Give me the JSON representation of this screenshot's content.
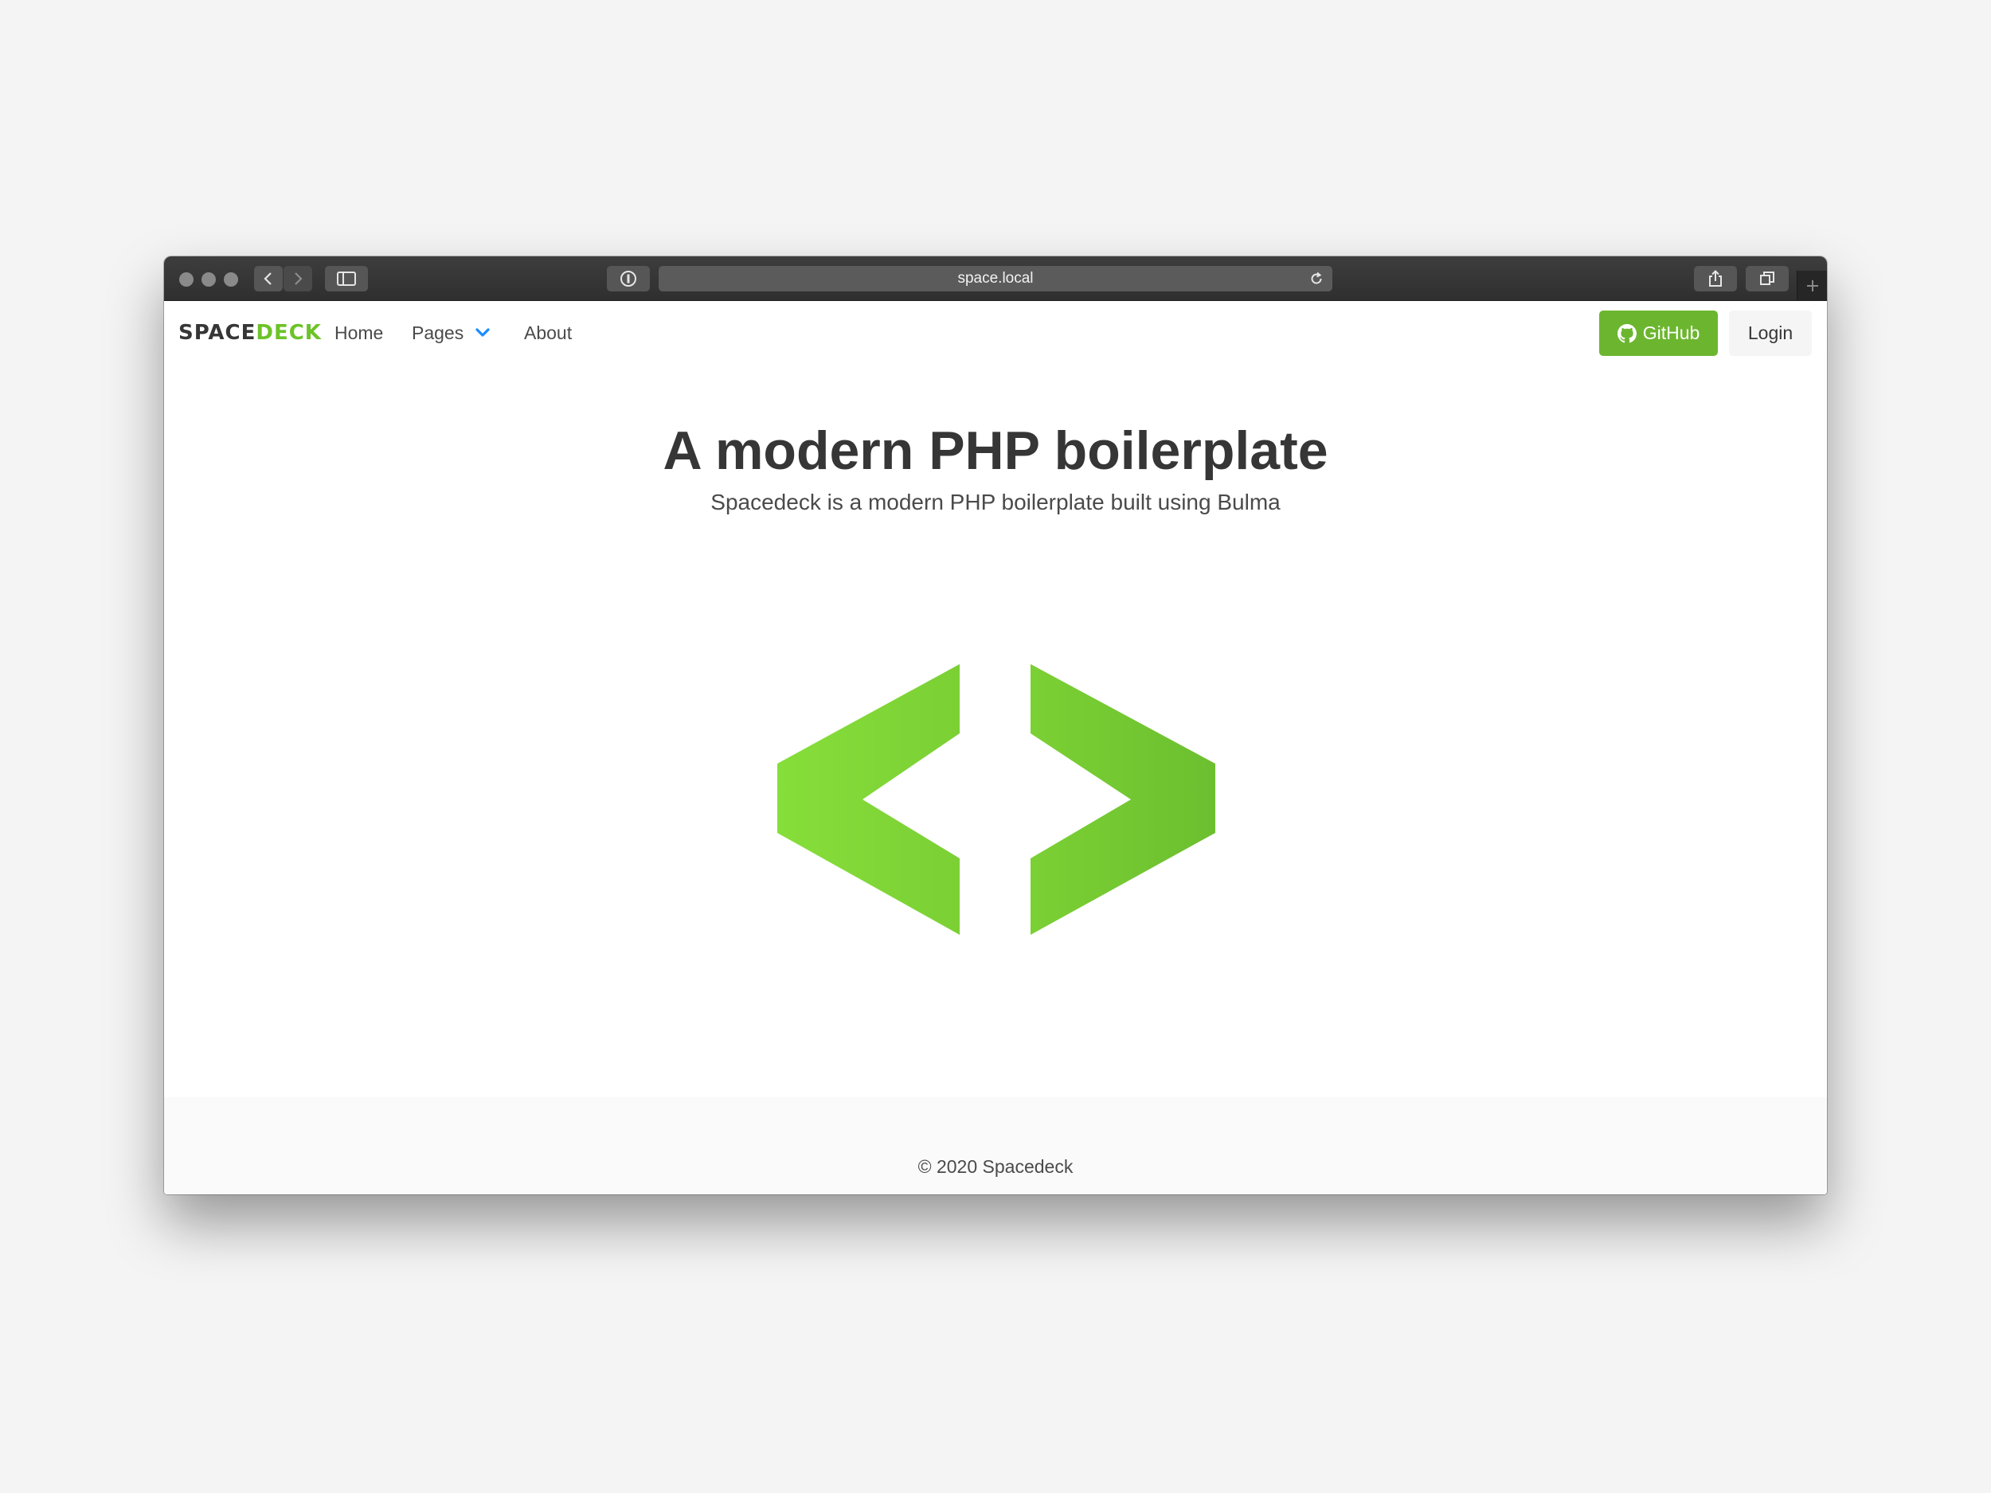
{
  "browser": {
    "url": "space.local"
  },
  "navbar": {
    "brand_part1": "SPACE",
    "brand_part2": "DECK",
    "items": [
      {
        "label": "Home"
      },
      {
        "label": "Pages"
      },
      {
        "label": "About"
      }
    ],
    "github_label": "GitHub",
    "login_label": "Login"
  },
  "hero": {
    "title": "A modern PHP boilerplate",
    "subtitle": "Spacedeck is a modern PHP boilerplate built using Bulma"
  },
  "footer": {
    "text": "© 2020 Spacedeck"
  },
  "colors": {
    "brand_green": "#6cc328",
    "github_button": "#6cb62f",
    "dropdown_chevron": "#1a8cff",
    "text_dark": "#363636"
  },
  "icons": {
    "github": "github-icon",
    "dropdown": "chevron-down-icon",
    "logo": "code-brackets-logo"
  }
}
